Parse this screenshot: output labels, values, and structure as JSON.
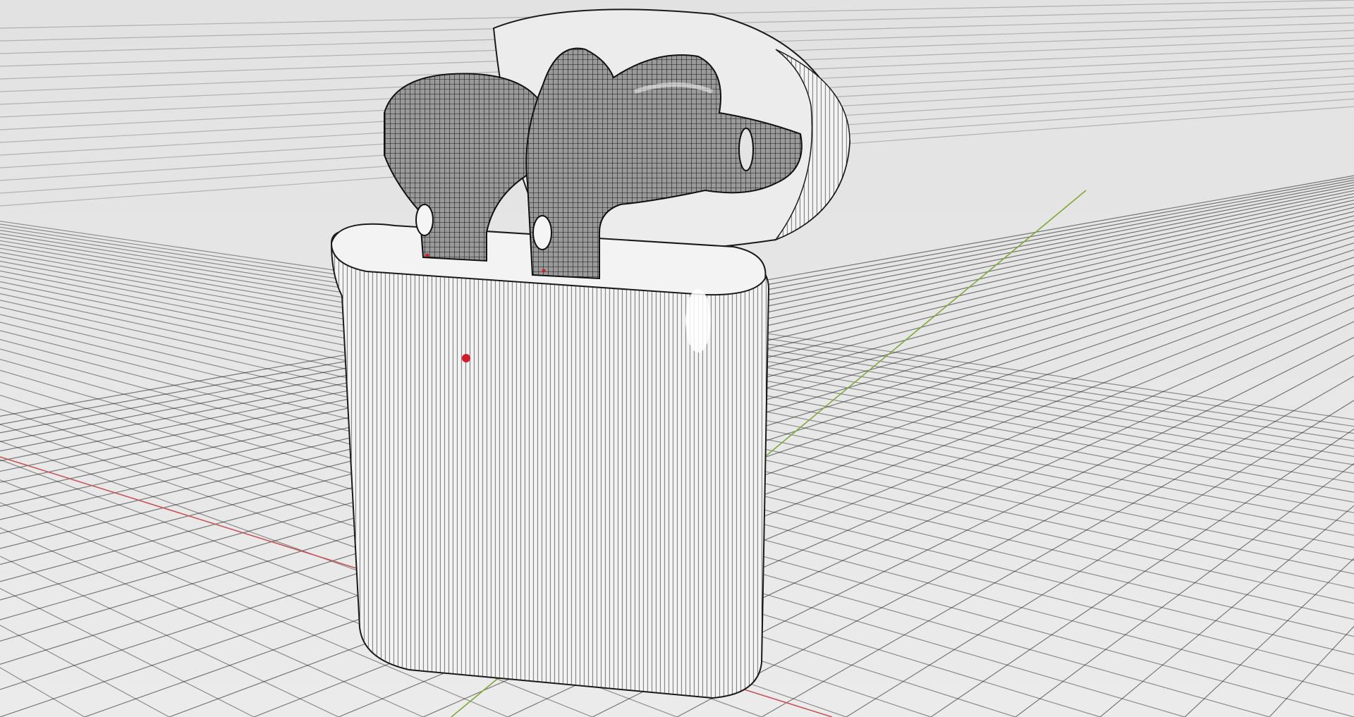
{
  "viewport": {
    "background": "#e6e6e6",
    "grid_color": "#1a1a1a",
    "x_axis_color": "#c8545a",
    "y_axis_color": "#7fa83a"
  },
  "model": {
    "case_color": "#f2f2f2",
    "wire_color": "#111111",
    "marker_color": "#d11a2a"
  }
}
